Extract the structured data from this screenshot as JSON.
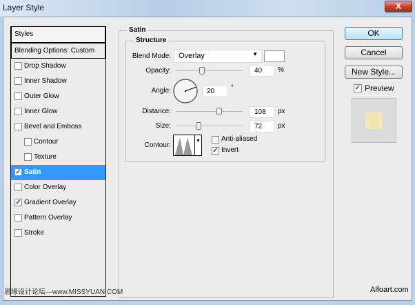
{
  "window": {
    "title": "Layer Style",
    "close": "X"
  },
  "sidebar": {
    "header": "Styles",
    "items": [
      {
        "label": "Blending Options: Custom",
        "type": "hdr"
      },
      {
        "label": "Drop Shadow",
        "checked": false
      },
      {
        "label": "Inner Shadow",
        "checked": false
      },
      {
        "label": "Outer Glow",
        "checked": false
      },
      {
        "label": "Inner Glow",
        "checked": false
      },
      {
        "label": "Bevel and Emboss",
        "checked": false
      },
      {
        "label": "Contour",
        "checked": false,
        "sub": true
      },
      {
        "label": "Texture",
        "checked": false,
        "sub": true
      },
      {
        "label": "Satin",
        "checked": true,
        "selected": true
      },
      {
        "label": "Color Overlay",
        "checked": false
      },
      {
        "label": "Gradient Overlay",
        "checked": true
      },
      {
        "label": "Pattern Overlay",
        "checked": false
      },
      {
        "label": "Stroke",
        "checked": false
      }
    ]
  },
  "satin": {
    "title": "Satin",
    "structure": "Structure",
    "blend_mode_label": "Blend Mode:",
    "blend_mode": "Overlay",
    "blend_color": "#ffffff",
    "opacity_label": "Opacity:",
    "opacity": "40",
    "opacity_unit": "%",
    "angle_label": "Angle:",
    "angle": "20",
    "angle_unit": "°",
    "distance_label": "Distance:",
    "distance": "108",
    "distance_unit": "px",
    "size_label": "Size:",
    "size": "72",
    "size_unit": "px",
    "contour_label": "Contour:",
    "anti_aliased": "Anti-aliased",
    "invert": "Invert"
  },
  "buttons": {
    "ok": "OK",
    "cancel": "Cancel",
    "new_style": "New Style...",
    "preview": "Preview"
  },
  "watermarks": {
    "left": "思缘设计论坛—www.MISSYUAN.COM",
    "right": "Alfoart.com"
  }
}
